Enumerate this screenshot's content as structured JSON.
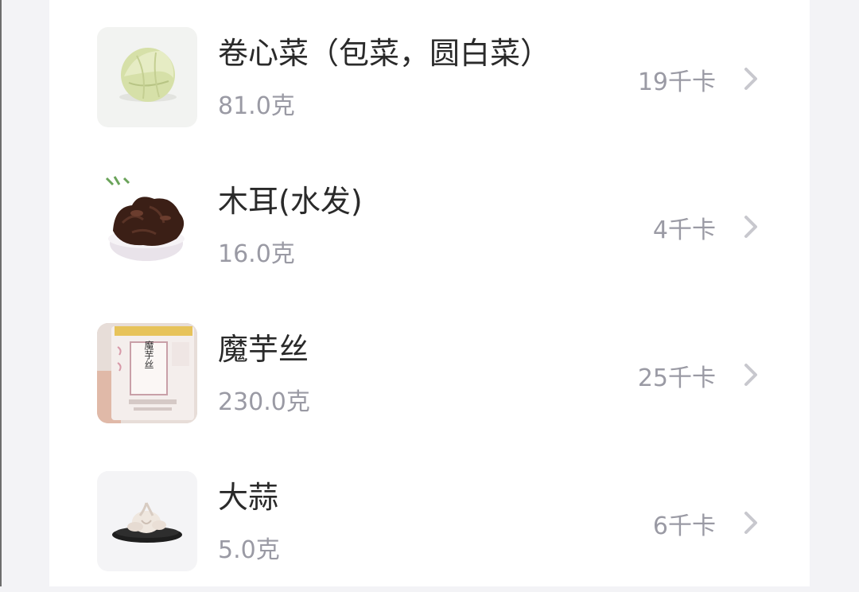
{
  "food_list": {
    "items": [
      {
        "name": "卷心菜（包菜，圆白菜）",
        "weight": "81.0克",
        "calories": "19千卡",
        "icon": "cabbage-image"
      },
      {
        "name": "木耳(水发)",
        "weight": "16.0克",
        "calories": "4千卡",
        "icon": "wood-ear-image"
      },
      {
        "name": "魔芋丝",
        "weight": "230.0克",
        "calories": "25千卡",
        "icon": "konjac-package-image",
        "package_text": "魔芋丝"
      },
      {
        "name": "大蒜",
        "weight": "5.0克",
        "calories": "6千卡",
        "icon": "garlic-image"
      }
    ]
  },
  "colors": {
    "title_text": "#2a2a2a",
    "secondary_text": "#9a9aa4",
    "chevron": "#c8c8ce",
    "card_bg": "#ffffff",
    "page_bg": "#f3f3f6"
  }
}
